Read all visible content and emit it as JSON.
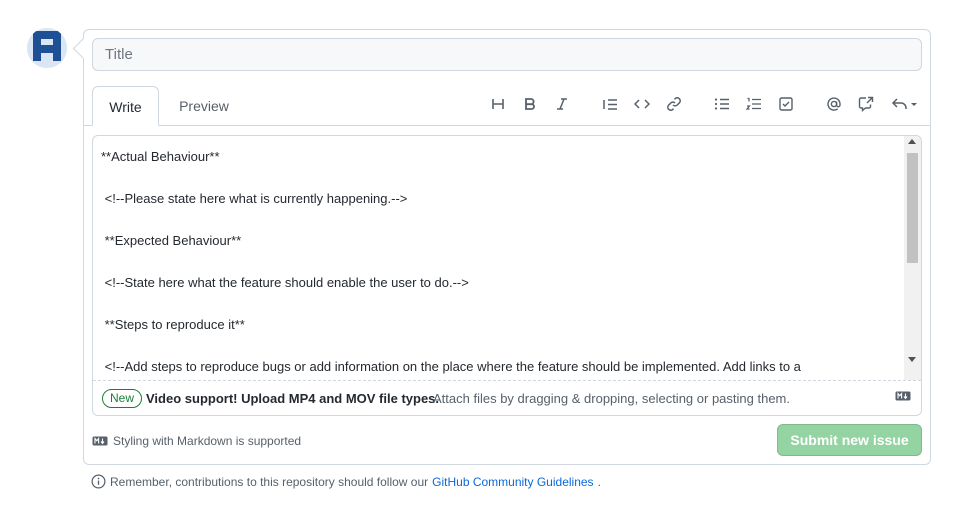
{
  "avatar": {
    "icon": "identicon-avatar",
    "color": "#1f4f94",
    "bg": "#dbe6f5"
  },
  "title_input": {
    "value": "",
    "placeholder": "Title"
  },
  "tabs": [
    {
      "label": "Write",
      "active": true
    },
    {
      "label": "Preview",
      "active": false
    }
  ],
  "toolbar": [
    {
      "name": "heading-icon",
      "glyph": "H"
    },
    {
      "name": "bold-icon",
      "glyph": "B"
    },
    {
      "name": "italic-icon",
      "glyph": "I"
    },
    {
      "name": "quote-icon"
    },
    {
      "name": "code-icon"
    },
    {
      "name": "link-icon"
    },
    {
      "name": "unordered-list-icon"
    },
    {
      "name": "ordered-list-icon"
    },
    {
      "name": "task-list-icon"
    },
    {
      "name": "mention-icon"
    },
    {
      "name": "cross-reference-icon"
    },
    {
      "name": "saved-replies-icon"
    }
  ],
  "editor": {
    "lines": [
      "**Actual Behaviour**",
      "",
      " <!--Please state here what is currently happening.-->",
      "",
      " **Expected Behaviour**",
      "",
      " <!--State here what the feature should enable the user to do.-->",
      "",
      " **Steps to reproduce it**",
      "",
      " <!--Add steps to reproduce bugs or add information on the place where the feature should be implemented. Add links to a"
    ]
  },
  "dropzone": {
    "badge": "New",
    "bold_text": "Video support! Upload MP4 and MOV file types.",
    "text": "Attach files by dragging & dropping, selecting or pasting them."
  },
  "footer": {
    "markdown_note": "Styling with Markdown is supported",
    "submit_label": "Submit new issue"
  },
  "guidelines": {
    "text": "Remember, contributions to this repository should follow our",
    "link": "GitHub Community Guidelines",
    "suffix": "."
  },
  "colors": {
    "accent_green": "#1a7f37",
    "submit_disabled": "#94d3a2",
    "link": "#0969da"
  }
}
